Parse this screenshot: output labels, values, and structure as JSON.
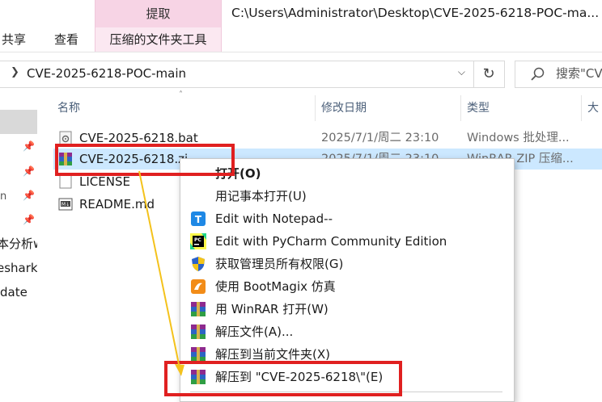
{
  "window": {
    "title": "C:\\Users\\Administrator\\Desktop\\CVE-2025-6218-POC-ma..."
  },
  "ribbon": {
    "tabs": [
      "共享",
      "查看"
    ],
    "context_group_title": "提取",
    "context_tab": "压缩的文件夹工具"
  },
  "address_bar": {
    "path": "CVE-2025-6218-POC-main",
    "search_placeholder": "搜索\"CVE"
  },
  "nav_pane": {
    "labels": [
      "本分析w",
      "eshark_",
      "date"
    ]
  },
  "columns": {
    "name": "名称",
    "date_modified": "修改日期",
    "type": "类型",
    "size": "大"
  },
  "files": [
    {
      "name": "CVE-2025-6218.bat",
      "date": "2025/7/1/周二 23:10",
      "type": "Windows 批处理...",
      "icon": "batch-file-icon"
    },
    {
      "name": "CVE-2025-6218.zi",
      "date": "2025/7/1/周二 23:10",
      "type": "WinRAR ZIP 压缩...",
      "icon": "winrar-zip-icon",
      "selected": true
    },
    {
      "name": "LICENSE",
      "date": "",
      "type": "",
      "icon": "blank-file-icon"
    },
    {
      "name": "README.md",
      "date": "",
      "type": "",
      "icon": "markdown-file-icon"
    }
  ],
  "context_menu": {
    "items": [
      {
        "label": "打开(O)",
        "icon": "",
        "bold": true
      },
      {
        "label": "用记事本打开(U)",
        "icon": ""
      },
      {
        "label": "Edit with Notepad--",
        "icon": "notepad-icon"
      },
      {
        "label": "Edit with PyCharm Community Edition",
        "icon": "pycharm-icon"
      },
      {
        "label": "获取管理员所有权限(G)",
        "icon": "uac-shield-icon"
      },
      {
        "label": "使用 BootMagix 仿真",
        "icon": "bootmagix-icon"
      },
      {
        "label": "用 WinRAR 打开(W)",
        "icon": "winrar-icon"
      },
      {
        "label": "解压文件(A)...",
        "icon": "winrar-icon"
      },
      {
        "label": "解压到当前文件夹(X)",
        "icon": "winrar-icon"
      },
      {
        "label": "解压到 \"CVE-2025-6218\\\"(E)",
        "icon": "winrar-icon"
      }
    ]
  },
  "colors": {
    "selection": "#cce8ff",
    "context_ribbon": "#f7d4e5",
    "annotation_red": "#e02020",
    "annotation_arrow": "#f4c21c"
  }
}
